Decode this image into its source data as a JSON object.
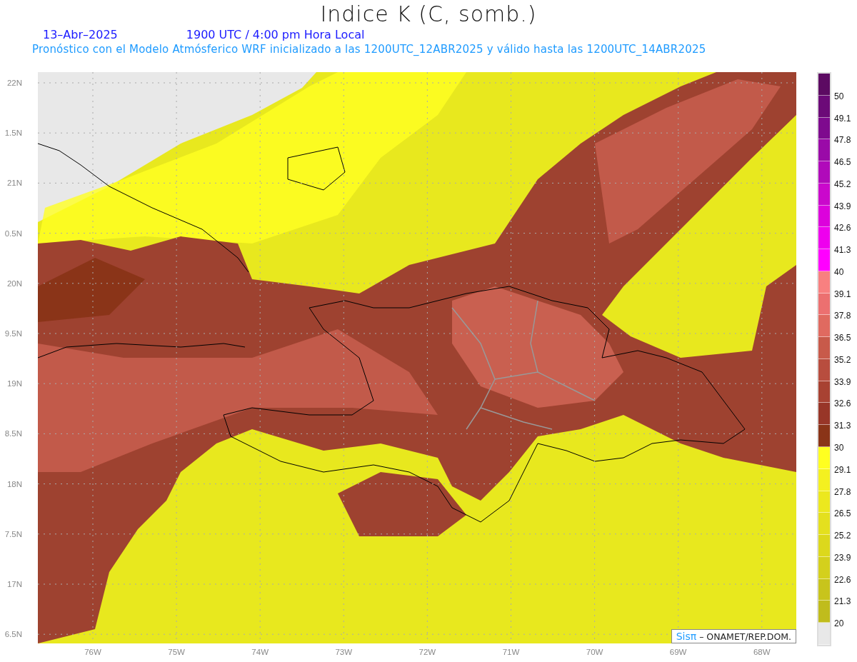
{
  "title": "Indice K (C, somb.)",
  "date": "13–Abr–2025",
  "time": "1900 UTC / 4:00 pm Hora Local",
  "subtitle": "Pronóstico con el Modelo Atmósferico WRF inicializado a las 1200UTC_12ABR2025 y válido hasta las  1200UTC_14ABR2025",
  "latitude_labels": [
    "22N",
    "1.5N",
    "21N",
    "0.5N",
    "20N",
    "9.5N",
    "19N",
    "8.5N",
    "18N",
    "7.5N",
    "17N",
    "6.5N"
  ],
  "longitude_labels": [
    "76W",
    "75W",
    "74W",
    "73W",
    "72W",
    "71W",
    "70W",
    "69W",
    "68W"
  ],
  "credit": {
    "brand": "Sisπ",
    "text": "– ONAMET/REP.DOM."
  },
  "legend": [
    {
      "label": "50",
      "color": "#5c0a62"
    },
    {
      "label": "49.1",
      "color": "#6c0a78"
    },
    {
      "label": "47.8",
      "color": "#7e0a8e"
    },
    {
      "label": "46.5",
      "color": "#9a0aa8"
    },
    {
      "label": "45.2",
      "color": "#b00aba"
    },
    {
      "label": "43.9",
      "color": "#ca08cc"
    },
    {
      "label": "42.6",
      "color": "#dc02dc"
    },
    {
      "label": "41.3",
      "color": "#ee00ee"
    },
    {
      "label": "40",
      "color": "#ff00ff"
    },
    {
      "label": "39.1",
      "color": "#f88080"
    },
    {
      "label": "37.8",
      "color": "#ec7070"
    },
    {
      "label": "36.5",
      "color": "#e06a60"
    },
    {
      "label": "35.2",
      "color": "#c85a4a"
    },
    {
      "label": "33.9",
      "color": "#b84d3e"
    },
    {
      "label": "32.6",
      "color": "#a84232"
    },
    {
      "label": "31.3",
      "color": "#983628"
    },
    {
      "label": "30",
      "color": "#8a3418"
    },
    {
      "label": "29.1",
      "color": "#ffff20"
    },
    {
      "label": "27.8",
      "color": "#f4f020"
    },
    {
      "label": "26.5",
      "color": "#ece81e"
    },
    {
      "label": "25.2",
      "color": "#e4e01e"
    },
    {
      "label": "23.9",
      "color": "#dcd81c"
    },
    {
      "label": "22.6",
      "color": "#d4d01c"
    },
    {
      "label": "21.3",
      "color": "#c8c41c"
    },
    {
      "label": "20",
      "color": "#c0bc1c"
    }
  ]
}
